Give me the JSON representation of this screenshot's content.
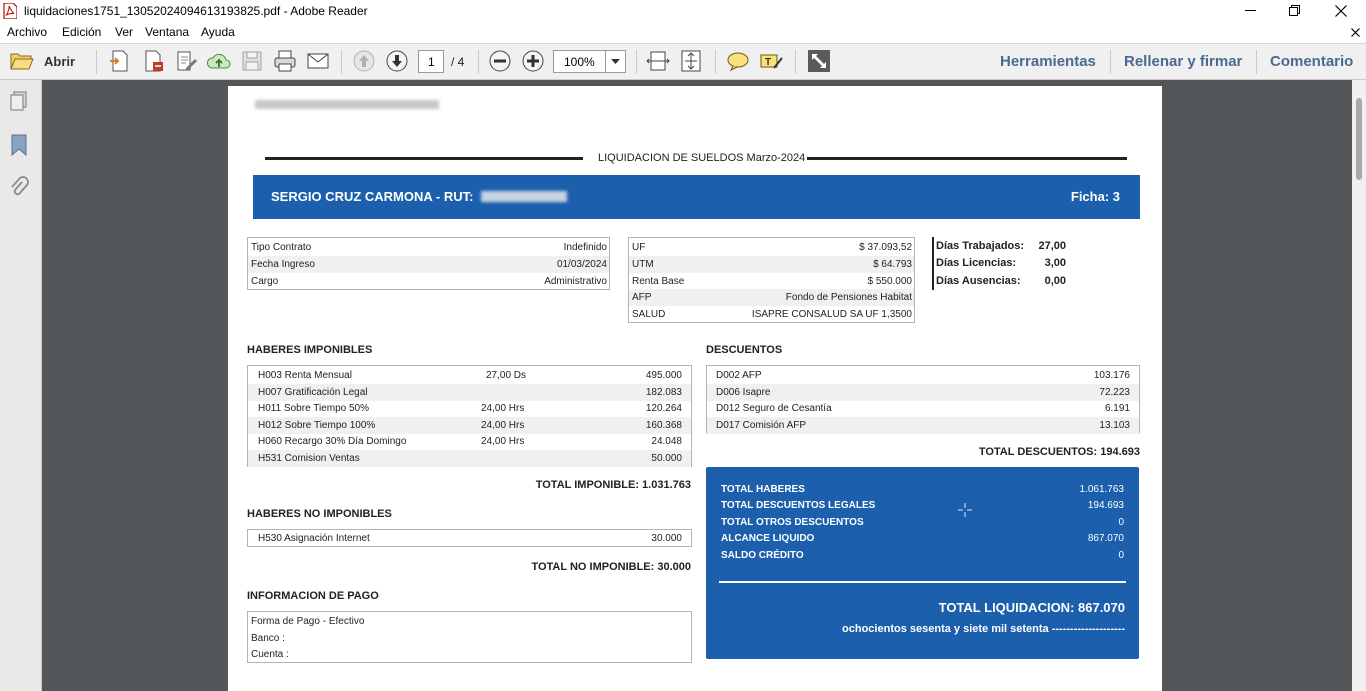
{
  "window": {
    "title": "liquidaciones1751_13052024094613193825.pdf - Adobe Reader"
  },
  "menu": [
    "Archivo",
    "Edición",
    "Ver",
    "Ventana",
    "Ayuda"
  ],
  "toolbar": {
    "open_label": "Abrir",
    "page_current": "1",
    "page_total": "/ 4",
    "zoom": "100%",
    "panels": [
      "Herramientas",
      "Rellenar y firmar",
      "Comentario"
    ]
  },
  "doc": {
    "title": "LIQUIDACION DE SUELDOS Marzo-2024",
    "employee": {
      "name_rut": "SERGIO CRUZ CARMONA - RUT:",
      "ficha": "Ficha: 3"
    },
    "contract": [
      {
        "label": "Tipo Contrato",
        "value": "Indefinido"
      },
      {
        "label": "Fecha Ingreso",
        "value": "01/03/2024"
      },
      {
        "label": "Cargo",
        "value": "Administrativo"
      }
    ],
    "params": [
      {
        "label": "UF",
        "value": "$ 37.093,52"
      },
      {
        "label": "UTM",
        "value": "$ 64.793"
      },
      {
        "label": "Renta Base",
        "value": "$ 550.000"
      },
      {
        "label": "AFP",
        "value": "Fondo de Pensiones Habitat"
      },
      {
        "label": "SALUD",
        "value": "ISAPRE CONSALUD SA UF 1,3500"
      }
    ],
    "days": [
      {
        "label": "Días Trabajados:",
        "value": "27,00"
      },
      {
        "label": "Días Licencias:",
        "value": "3,00"
      },
      {
        "label": "Días Ausencias:",
        "value": "0,00"
      }
    ],
    "imponibles": {
      "heading": "HABERES IMPONIBLES",
      "rows": [
        {
          "concept": "H003 Renta Mensual",
          "qty": "27,00 Ds",
          "amount": "495.000"
        },
        {
          "concept": "H007 Gratificación Legal",
          "qty": "",
          "amount": "182.083"
        },
        {
          "concept": "H011 Sobre Tiempo 50%",
          "qty": "24,00 Hrs",
          "amount": "120.264"
        },
        {
          "concept": "H012 Sobre Tiempo 100%",
          "qty": "24,00 Hrs",
          "amount": "160.368"
        },
        {
          "concept": "H060 Recargo 30% Día Domingo",
          "qty": "24,00 Hrs",
          "amount": "24.048"
        },
        {
          "concept": "H531 Comision Ventas",
          "qty": "",
          "amount": "50.000"
        }
      ],
      "total": "TOTAL IMPONIBLE: 1.031.763"
    },
    "no_imponibles": {
      "heading": "HABERES NO IMPONIBLES",
      "rows": [
        {
          "concept": "H530 Asignación Internet",
          "amount": "30.000"
        }
      ],
      "total": "TOTAL NO IMPONIBLE: 30.000"
    },
    "pago": {
      "heading": "INFORMACION DE PAGO",
      "rows": [
        "Forma de Pago - Efectivo",
        "Banco :",
        "Cuenta :"
      ]
    },
    "descuentos": {
      "heading": "DESCUENTOS",
      "rows": [
        {
          "concept": "D002 AFP",
          "amount": "103.176"
        },
        {
          "concept": "D006 Isapre",
          "amount": "72.223"
        },
        {
          "concept": "D012 Seguro de Cesantía",
          "amount": "6.191"
        },
        {
          "concept": "D017 Comisión AFP",
          "amount": "13.103"
        }
      ],
      "total": "TOTAL DESCUENTOS: 194.693"
    },
    "summary": {
      "rows": [
        {
          "label": "TOTAL HABERES",
          "value": "1.061.763"
        },
        {
          "label": "TOTAL DESCUENTOS LEGALES",
          "value": "194.693"
        },
        {
          "label": "TOTAL OTROS DESCUENTOS",
          "value": "0"
        },
        {
          "label": "ALCANCE LIQUIDO",
          "value": "867.070"
        },
        {
          "label": "SALDO CRÉDITO",
          "value": "0"
        }
      ],
      "total": "TOTAL LIQUIDACION: 867.070",
      "in_words": "ochocientos sesenta y siete mil setenta --------------------"
    }
  },
  "colors": {
    "accent_blue": "#1b5fad",
    "panel_link": "#4a6a90",
    "doc_background": "#525659"
  }
}
